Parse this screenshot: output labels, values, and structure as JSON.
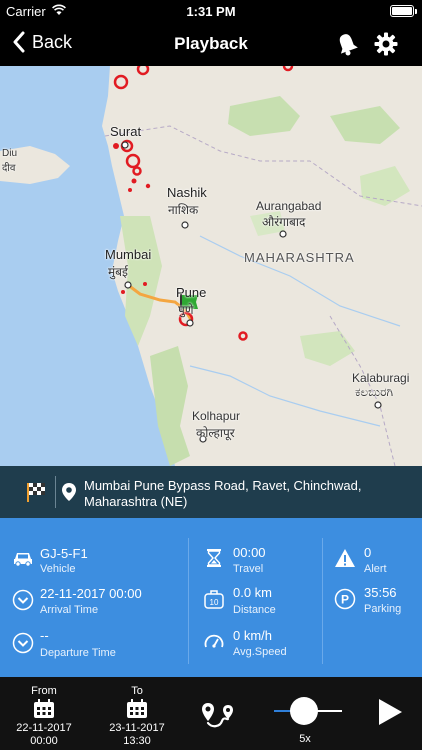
{
  "status": {
    "carrier": "Carrier",
    "time": "1:31 PM"
  },
  "nav": {
    "back_label": "Back",
    "title": "Playback"
  },
  "map": {
    "labels": {
      "surat": "Surat",
      "diu_en": "Diu",
      "diu_hi": "दीव",
      "nashik_en": "Nashik",
      "nashik_hi": "नाशिक",
      "aurangabad_en": "Aurangabad",
      "aurangabad_hi": "औरंगाबाद",
      "maharashtra": "MAHARASHTRA",
      "mumbai_en": "Mumbai",
      "mumbai_hi": "मुंबई",
      "pune_en": "Pune",
      "pune_hi": "पुणे",
      "kolhapur_en": "Kolhapur",
      "kolhapur_hi": "कोल्हापूर",
      "kalaburagi_en": "Kalaburagi",
      "kalaburagi_kn": "ಕಲಬುರಗಿ"
    }
  },
  "address": {
    "text": "Mumbai Pune Bypass Road, Ravet, Chinchwad, Maharashtra (NE)"
  },
  "stats": {
    "vehicle_value": "GJ-5-F1",
    "vehicle_label": "Vehicle",
    "arrival_value": "22-11-2017 00:00",
    "arrival_label": "Arrival Time",
    "departure_value": "--",
    "departure_label": "Departure Time",
    "travel_value": "00:00",
    "travel_label": "Travel",
    "distance_value": "0.0 km",
    "distance_label": "Distance",
    "speed_value": "0 km/h",
    "speed_label": "Avg.Speed",
    "alert_value": "0",
    "alert_label": "Alert",
    "parking_value": "35:56",
    "parking_label": "Parking"
  },
  "bottom": {
    "from_label": "From",
    "from_date": "22-11-2017",
    "from_time": "00:00",
    "to_label": "To",
    "to_date": "23-11-2017",
    "to_time": "13:30",
    "speed_label": "5x",
    "speed_fraction": 0.44
  },
  "colors": {
    "stats_bg": "#3d8ee0",
    "address_bg": "#1f3d4d",
    "marker_red": "#e11b22",
    "flag_green": "#2fa833",
    "route_orange": "#f4a640"
  }
}
